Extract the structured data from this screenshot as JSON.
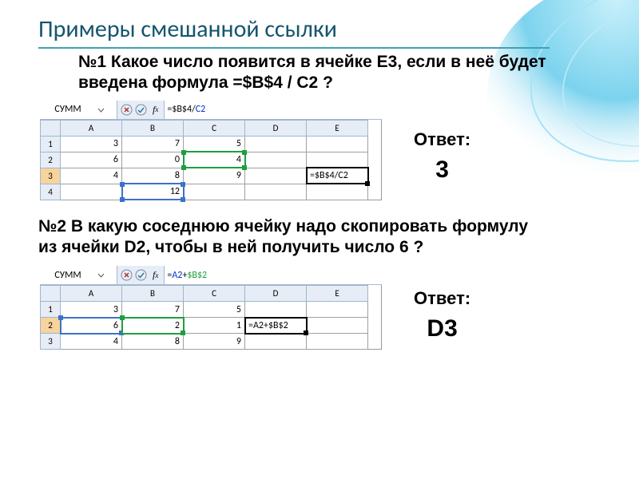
{
  "title": "Примеры смешанной ссылки",
  "q1": "№1 Какое число появится в ячейке  Е3, если в неё будет введена формула  =$B$4 / С2 ?",
  "q2": "№2 В какую соседнюю ячейку надо скопировать формулу из ячейки D2, чтобы в ней получить число  6 ?",
  "answer_label": "Ответ:",
  "answer1": "3",
  "answer2": "D3",
  "ss1": {
    "namebox": "СУММ",
    "formula_plain": "=$B$4/",
    "formula_tail": "C2",
    "cols": [
      "A",
      "B",
      "C",
      "D",
      "E"
    ],
    "rows": [
      "1",
      "2",
      "3",
      "4"
    ],
    "data": {
      "A1": "3",
      "B1": "7",
      "C1": "5",
      "D1": "",
      "E1": "",
      "A2": "6",
      "B2": "0",
      "C2": "4",
      "D2": "",
      "E2": "",
      "A3": "4",
      "B3": "8",
      "C3": "9",
      "D3": "",
      "E3": "=$B$4/C2",
      "A4": "",
      "B4": "12",
      "C4": "",
      "D4": "",
      "E4": ""
    }
  },
  "ss2": {
    "namebox": "СУММ",
    "formula_plain": "=",
    "formula_a": "A2",
    "formula_mid": "+",
    "formula_b": "$B$2",
    "cols": [
      "A",
      "B",
      "C",
      "D",
      "E"
    ],
    "rows": [
      "1",
      "2",
      "3"
    ],
    "data": {
      "A1": "3",
      "B1": "7",
      "C1": "5",
      "D1": "",
      "E1": "",
      "A2": "6",
      "B2": "2",
      "C2": "1",
      "D2": "=A2+$B$2",
      "E2": "",
      "A3": "4",
      "B3": "8",
      "C3": "9",
      "D3": "",
      "E3": ""
    }
  }
}
